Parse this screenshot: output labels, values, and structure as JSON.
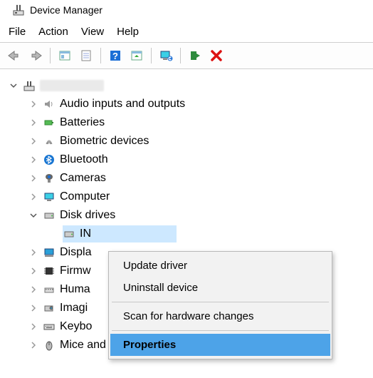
{
  "window": {
    "title": "Device Manager"
  },
  "menu": {
    "file": "File",
    "action": "Action",
    "view": "View",
    "help": "Help"
  },
  "toolbar_icons": {
    "back": "back-arrow",
    "forward": "forward-arrow",
    "show_hidden": "show-hidden",
    "properties_sheet": "properties-sheet",
    "help": "help",
    "update": "update-driver",
    "monitor": "uninstall-device",
    "scan": "scan-hardware",
    "remove": "remove"
  },
  "tree": {
    "root_label": "",
    "items": [
      {
        "label": "Audio inputs and outputs"
      },
      {
        "label": "Batteries"
      },
      {
        "label": "Biometric devices"
      },
      {
        "label": "Bluetooth"
      },
      {
        "label": "Cameras"
      },
      {
        "label": "Computer"
      },
      {
        "label": "Disk drives",
        "expanded": true
      },
      {
        "label": "Display adapters",
        "truncated": "Displa"
      },
      {
        "label": "Firmware",
        "truncated": "Firmw"
      },
      {
        "label": "Human Interface Devices",
        "truncated": "Huma"
      },
      {
        "label": "Imaging devices",
        "truncated": "Imagi"
      },
      {
        "label": "Keyboards",
        "truncated": "Keybo"
      },
      {
        "label": "Mice and other pointing devices"
      }
    ],
    "selected_child": {
      "label": "IN"
    }
  },
  "context_menu": {
    "items": [
      {
        "label": "Update driver"
      },
      {
        "label": "Uninstall device"
      }
    ],
    "items2": [
      {
        "label": "Scan for hardware changes"
      }
    ],
    "highlight": {
      "label": "Properties"
    }
  }
}
